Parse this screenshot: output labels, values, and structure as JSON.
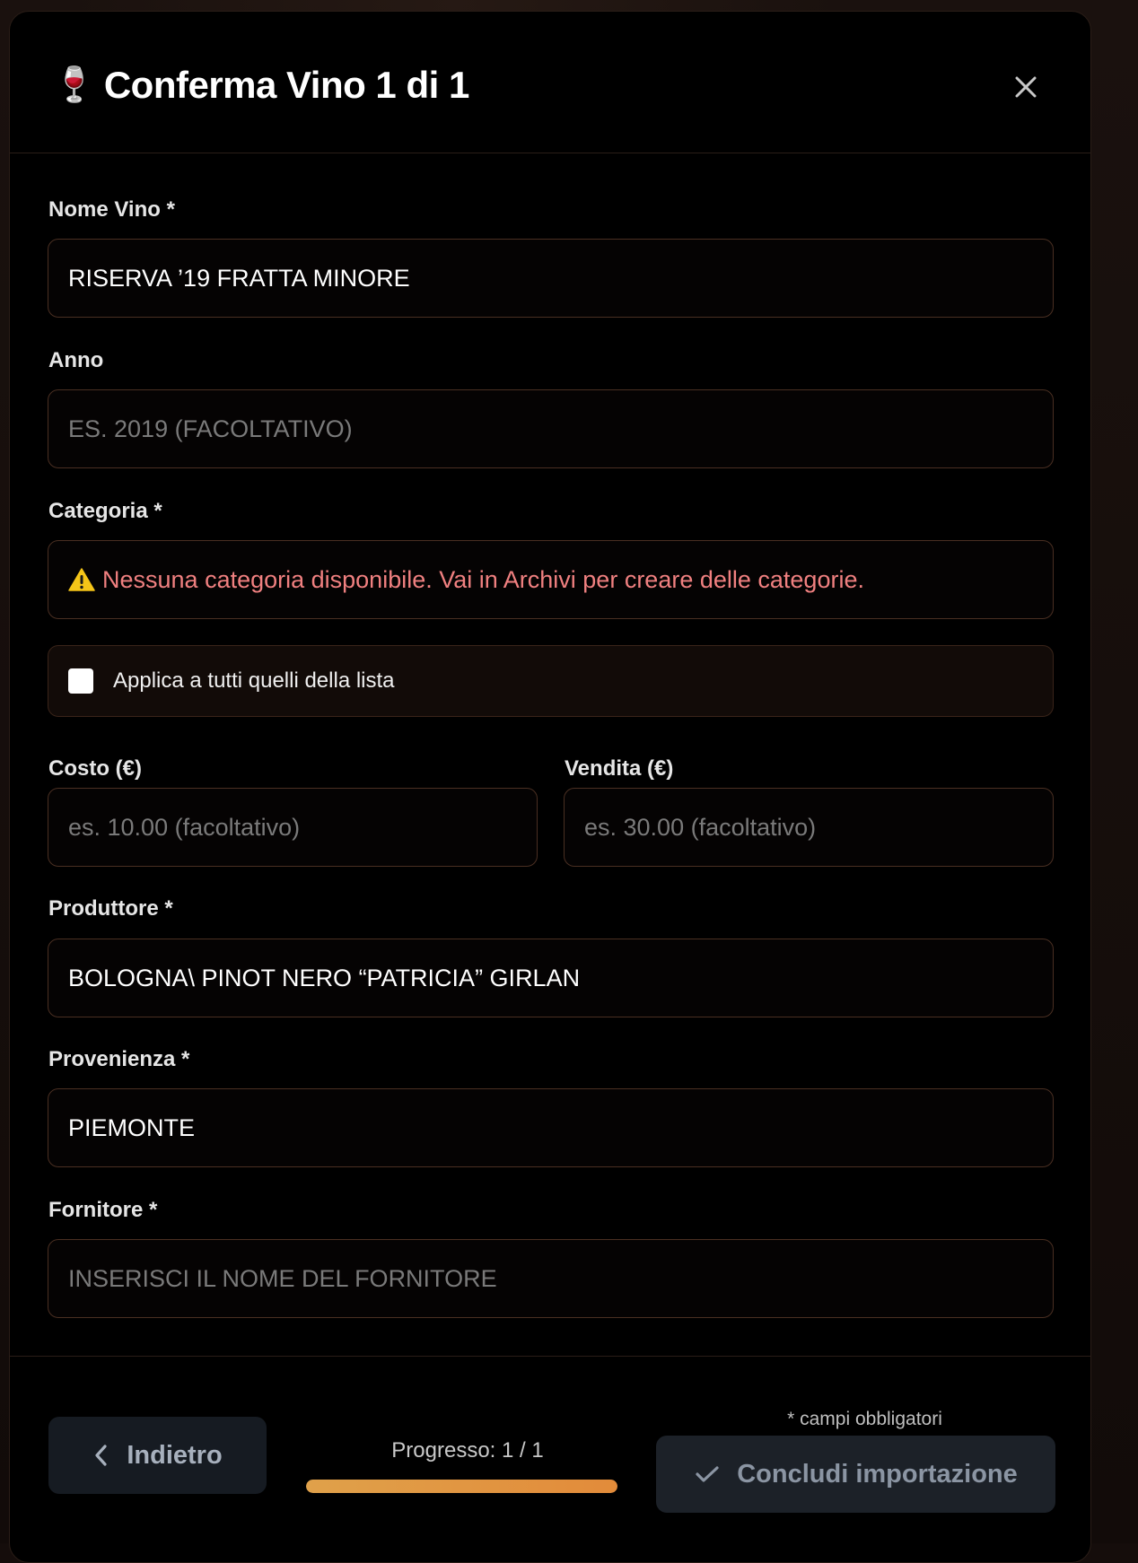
{
  "modal": {
    "title_icon": "wine-glass-icon",
    "title": "Conferma Vino 1 di 1",
    "close_icon": "close-icon"
  },
  "fields": {
    "nome_vino": {
      "label": "Nome Vino *",
      "value": "RISERVA ’19 FRATTA MINORE",
      "placeholder": ""
    },
    "anno": {
      "label": "Anno",
      "value": "",
      "placeholder": "ES. 2019 (FACOLTATIVO)"
    },
    "categoria": {
      "label": "Categoria *",
      "warning_icon": "warning-icon",
      "warning": "Nessuna categoria disponibile. Vai in Archivi per creare delle categorie."
    },
    "apply_all": {
      "label": "Applica a tutti quelli della lista",
      "checked": false
    },
    "costo": {
      "label": "Costo (€)",
      "value": "",
      "placeholder": "es. 10.00 (facoltativo)"
    },
    "vendita": {
      "label": "Vendita (€)",
      "value": "",
      "placeholder": "es. 30.00 (facoltativo)"
    },
    "produttore": {
      "label": "Produttore *",
      "value": "BOLOGNA\\ PINOT NERO “PATRICIA” GIRLAN",
      "placeholder": ""
    },
    "provenienza": {
      "label": "Provenienza *",
      "value": "PIEMONTE",
      "placeholder": ""
    },
    "fornitore": {
      "label": "Fornitore *",
      "value": "",
      "placeholder": "INSERISCI IL NOME DEL FORNITORE"
    }
  },
  "footer": {
    "back_label": "Indietro",
    "back_icon": "chevron-left-icon",
    "progress_label": "Progresso: 1 / 1",
    "progress_fraction": 1.0,
    "required_note": "* campi obbligatori",
    "submit_label": "Concludi importazione",
    "submit_icon": "check-icon"
  },
  "colors": {
    "accent": "#E29B45",
    "warning_text": "#F08080",
    "input_border": "#4A2F22"
  }
}
